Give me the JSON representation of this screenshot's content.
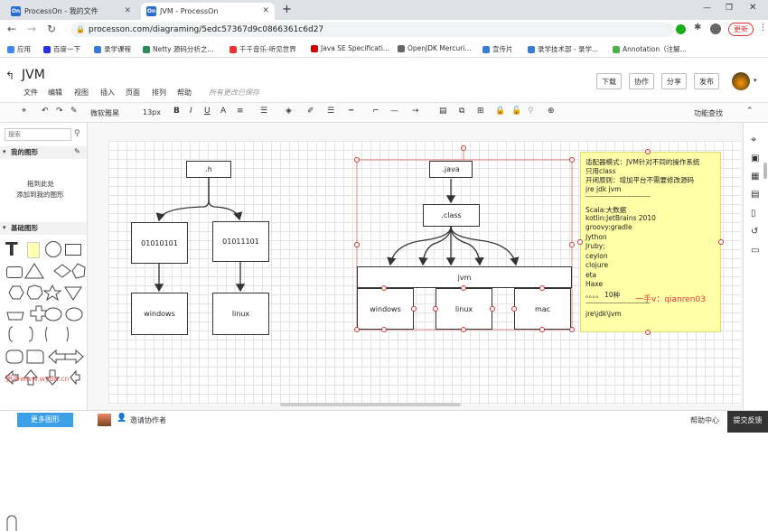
{
  "tabs": [
    {
      "title": "ProcessOn - 我的文件"
    },
    {
      "title": "JVM - ProcessOn"
    }
  ],
  "url": "processon.com/diagraming/5edc57367d9c0866361c6d27",
  "update_label": "更新",
  "bookmarks": [
    "应用",
    "百度一下",
    "录学课程",
    "Netty 源码分析之...",
    "千千音乐-听见世界",
    "Java SE Specificati...",
    "OpenJDK Mercuri...",
    "宣传片",
    "录学技术部 - 录学...",
    "Annotation（注解..."
  ],
  "app": {
    "title": "JVM",
    "menu": [
      "文件",
      "编辑",
      "视图",
      "插入",
      "页面",
      "排列",
      "帮助"
    ],
    "saved": "所有更改已保存",
    "buttons": {
      "download": "下载",
      "collab": "协作",
      "share": "分享",
      "publish": "发布"
    }
  },
  "toolbar": {
    "font": "微软雅黑",
    "size": "13px",
    "bold": "B",
    "italic": "I",
    "underline": "U",
    "text": "A",
    "find": "功能查找"
  },
  "left": {
    "search_placeholder": "搜索",
    "my_shapes": "我的图形",
    "drop1": "拖到此处",
    "drop2": "添加到我的图形",
    "basic": "基础图形",
    "more": "更多图形",
    "watermark": "更多www.wy8a.cn"
  },
  "canvas": {
    "left": {
      "h": ".h",
      "b1": "01010101",
      "b2": "01011101",
      "win": "windows",
      "linux": "linux"
    },
    "right": {
      "java": ".java",
      "class": ".class",
      "jvm": "jvm",
      "win": "windows",
      "linux": "linux",
      "mac": "mac"
    }
  },
  "note": {
    "lines": [
      "适配器模式：JVM针对不同的操作系统",
      "只用class",
      "开闭原则：增加平台不需要修改源码",
      "jre jdk jvm",
      "-------------------------------------------",
      "Scala:大数据",
      "kotlin:JetBrains 2010",
      "groovy:gradle",
      "Jython",
      "Jruby;",
      "ceylon",
      "clojure",
      "eta",
      "Haxe",
      "。。。。 10种",
      "-------------------------------------------",
      "jre\\jdk\\jvm"
    ],
    "wechat": "一手v：qianren03"
  },
  "footer": {
    "invite": "邀请协作者",
    "help": "帮助中心",
    "feedback": "提交反馈"
  }
}
